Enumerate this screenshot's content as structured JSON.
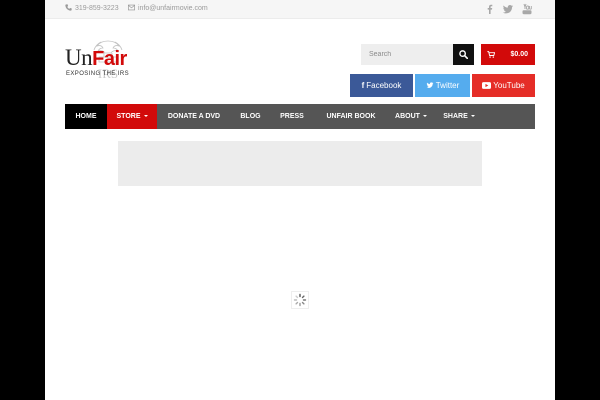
{
  "topbar": {
    "phone": "319-859-3223",
    "email": "info@unfairmovie.com",
    "social_icons": [
      "facebook-icon",
      "twitter-icon",
      "youtube-icon"
    ]
  },
  "logo": {
    "word_part1": "Un",
    "word_part2": "Fair",
    "tagline": "EXPOSING THE IRS",
    "seal_text": "IRS"
  },
  "search": {
    "placeholder": "Search"
  },
  "cart": {
    "total": "$0.00"
  },
  "social": {
    "facebook": "Facebook",
    "twitter": "Twitter",
    "youtube": "YouTube"
  },
  "nav": {
    "items": [
      {
        "label": "HOME",
        "active": true
      },
      {
        "label": "STORE",
        "dropdown": true,
        "highlight": true
      },
      {
        "label": "DONATE A DVD"
      },
      {
        "label": "BLOG"
      },
      {
        "label": "PRESS"
      },
      {
        "label": "UNFAIR BOOK"
      },
      {
        "label": "ABOUT",
        "dropdown": true
      },
      {
        "label": "SHARE",
        "dropdown": true
      }
    ]
  },
  "colors": {
    "brand_red": "#d20a0a",
    "nav_bg": "#555555",
    "facebook": "#3b5998",
    "twitter": "#55acee",
    "youtube": "#e52d27"
  }
}
